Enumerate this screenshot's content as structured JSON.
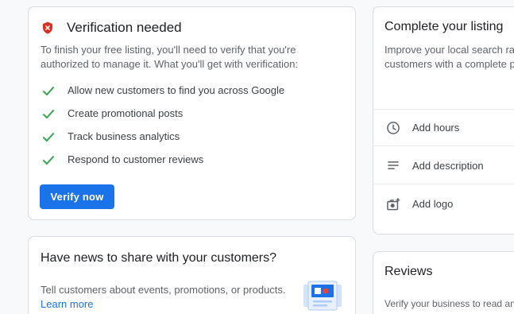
{
  "verification": {
    "title": "Verification needed",
    "description": "To finish your free listing, you'll need to verify that you're authorized to manage it. What you'll get with verification:",
    "benefits": [
      "Allow new customers to find you across Google",
      "Create promotional posts",
      "Track business analytics",
      "Respond to customer reviews"
    ],
    "button_label": "Verify now",
    "icon": "shield-alert-icon",
    "check_color": "#34a853",
    "accent": "#1a73e8"
  },
  "news": {
    "title": "Have news to share with your customers?",
    "description": "Tell customers about events, promotions, or products.",
    "link": "Learn more"
  },
  "listing": {
    "title": "Complete your listing",
    "description_line1": "Improve your local search rank",
    "description_line2": "customers with a complete pro",
    "items": [
      {
        "label": "Add hours",
        "icon": "clock-icon"
      },
      {
        "label": "Add description",
        "icon": "text-lines-icon"
      },
      {
        "label": "Add logo",
        "icon": "add-photo-icon"
      }
    ]
  },
  "reviews": {
    "title": "Reviews",
    "description": "Verify your business to read and"
  }
}
